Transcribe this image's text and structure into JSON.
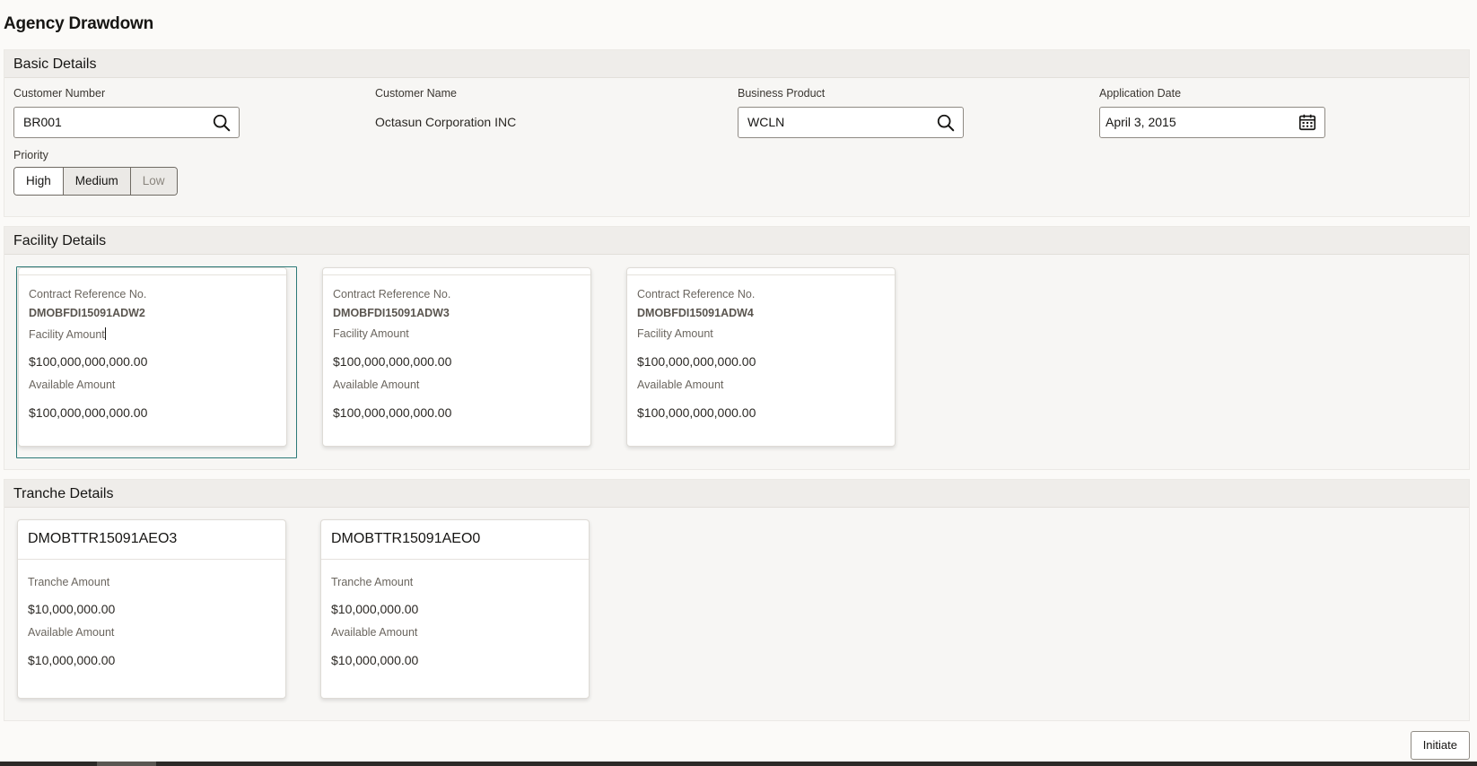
{
  "page": {
    "title": "Agency Drawdown"
  },
  "basic": {
    "header": "Basic Details",
    "customer_number": {
      "label": "Customer Number",
      "value": "BR001"
    },
    "customer_name": {
      "label": "Customer Name",
      "value": "Octasun Corporation INC"
    },
    "business_product": {
      "label": "Business Product",
      "value": "WCLN"
    },
    "application_date": {
      "label": "Application Date",
      "value": "April 3, 2015"
    },
    "priority": {
      "label": "Priority",
      "options": [
        "High",
        "Medium",
        "Low"
      ],
      "selected": "High"
    }
  },
  "facility": {
    "header": "Facility Details",
    "cards": [
      {
        "ref_label": "Contract Reference No.",
        "ref": "DMOBFDI15091ADW2",
        "facility_label": "Facility Amount",
        "facility_amount": "$100,000,000,000.00",
        "available_label": "Available Amount",
        "available_amount": "$100,000,000,000.00"
      },
      {
        "ref_label": "Contract Reference No.",
        "ref": "DMOBFDI15091ADW3",
        "facility_label": "Facility Amount",
        "facility_amount": "$100,000,000,000.00",
        "available_label": "Available Amount",
        "available_amount": "$100,000,000,000.00"
      },
      {
        "ref_label": "Contract Reference No.",
        "ref": "DMOBFDI15091ADW4",
        "facility_label": "Facility Amount",
        "facility_amount": "$100,000,000,000.00",
        "available_label": "Available Amount",
        "available_amount": "$100,000,000,000.00"
      }
    ]
  },
  "tranche": {
    "header": "Tranche Details",
    "cards": [
      {
        "ref": "DMOBTTR15091AEO3",
        "tranche_label": "Tranche Amount",
        "tranche_amount": "$10,000,000.00",
        "available_label": "Available Amount",
        "available_amount": "$10,000,000.00"
      },
      {
        "ref": "DMOBTTR15091AEO0",
        "tranche_label": "Tranche Amount",
        "tranche_amount": "$10,000,000.00",
        "available_label": "Available Amount",
        "available_amount": "$10,000,000.00"
      }
    ]
  },
  "actions": {
    "initiate": "Initiate"
  },
  "icons": {
    "search": "search-icon",
    "calendar": "calendar-icon"
  },
  "colors": {
    "selected_border": "#2d7a78",
    "section_header": "#efedea"
  }
}
